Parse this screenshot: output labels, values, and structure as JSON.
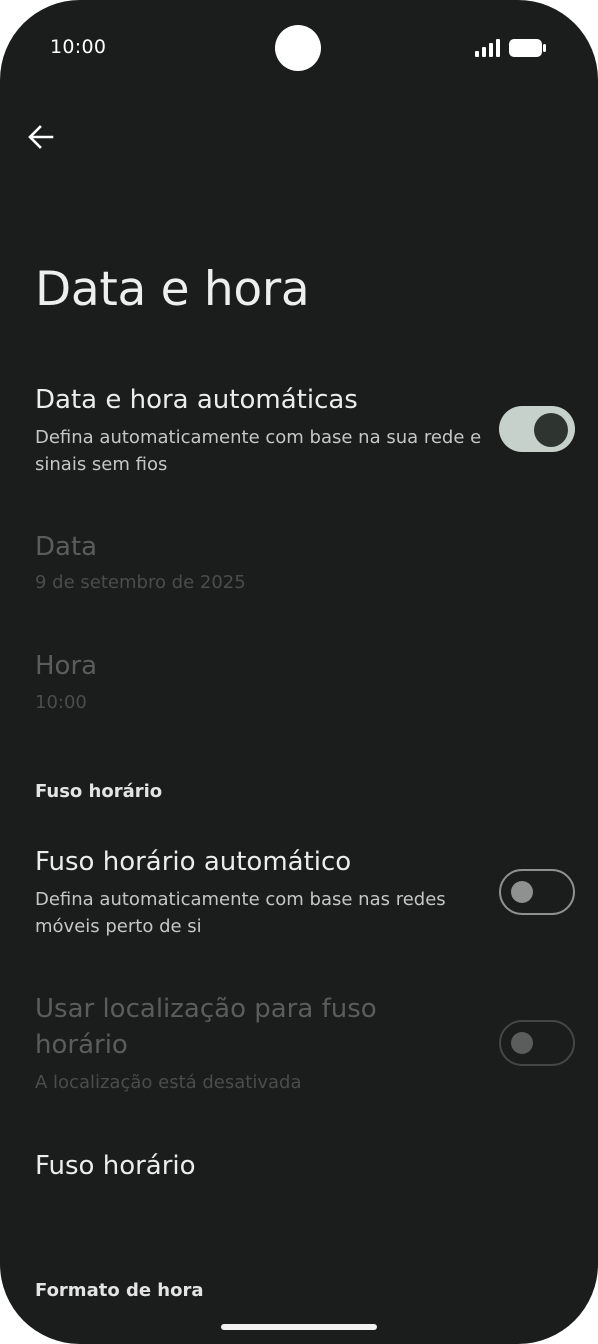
{
  "status_bar": {
    "time": "10:00",
    "signal_icon": "signal-icon",
    "battery_icon": "battery-icon"
  },
  "header": {
    "back_icon": "back-arrow-icon",
    "title": "Data e hora"
  },
  "settings": {
    "auto_datetime": {
      "title": "Data e hora automáticas",
      "subtitle": "Defina automaticamente com base na sua rede e sinais sem fios",
      "enabled": true
    },
    "date": {
      "title": "Data",
      "value": "9 de setembro de 2025"
    },
    "time": {
      "title": "Hora",
      "value": "10:00"
    },
    "timezone_section": {
      "header": "Fuso horário"
    },
    "auto_timezone": {
      "title": "Fuso horário automático",
      "subtitle": "Defina automaticamente com base nas redes móveis perto de si",
      "enabled": false
    },
    "location_timezone": {
      "title": "Usar localização para fuso horário",
      "subtitle": "A localização está desativada",
      "enabled": false
    },
    "timezone": {
      "title": "Fuso horário"
    },
    "time_format_section": {
      "header": "Formato de hora"
    }
  },
  "colors": {
    "background": "#1b1c1c",
    "toggle_on_track": "#c7d1cb",
    "toggle_on_thumb": "#2e3531",
    "toggle_off": "#8e918f"
  }
}
